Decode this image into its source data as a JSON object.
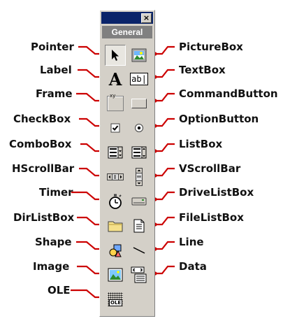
{
  "toolbox": {
    "tab_label": "General",
    "close_glyph": "×"
  },
  "left_labels": [
    "Pointer",
    "Label",
    "Frame",
    "CheckBox",
    "ComboBox",
    "HScrollBar",
    "Timer",
    "DirListBox",
    "Shape",
    "Image",
    "OLE"
  ],
  "right_labels": [
    "PictureBox",
    "TextBox",
    "CommandButton",
    "OptionButton",
    "ListBox",
    "VScrollBar",
    "DriveListBox",
    "FileListBox",
    "Line",
    "Data"
  ],
  "icons": {
    "label_glyph": "A",
    "textbox_text": "ab|",
    "frame_text": "xy",
    "ole_text": "OLE"
  },
  "colors": {
    "connector": "#cc0000",
    "title_bar": "#0a246a",
    "toolbox_face": "#d4d0c8"
  }
}
